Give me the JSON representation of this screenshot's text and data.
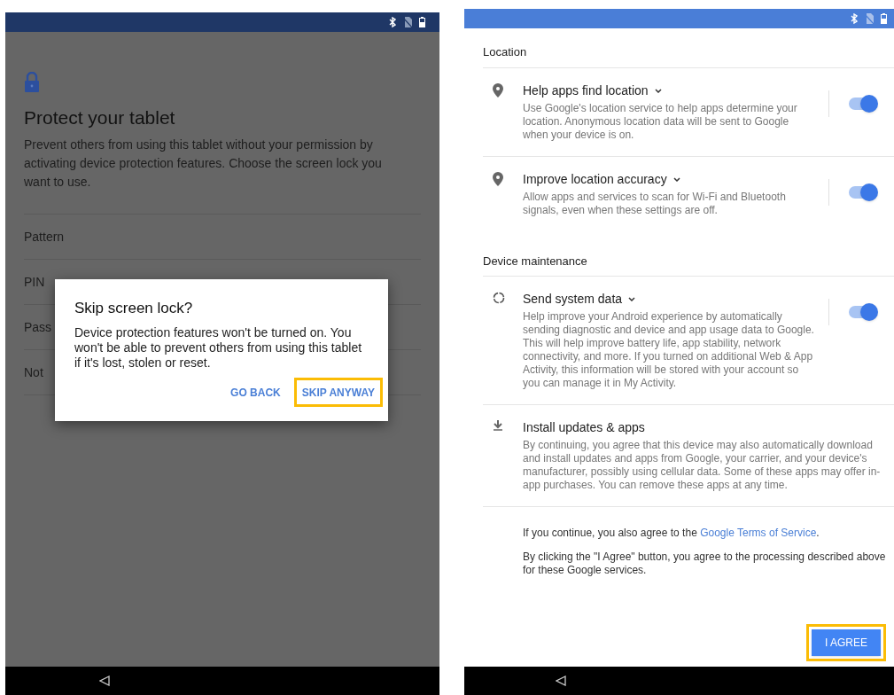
{
  "left_screen": {
    "title": "Protect your tablet",
    "description": "Prevent others from using this tablet without your permission by activating device protection features. Choose the screen lock you want to use.",
    "lock_options": [
      {
        "label": "Pattern"
      },
      {
        "label": "PIN"
      },
      {
        "label": "Pass"
      },
      {
        "label": "Not"
      }
    ],
    "dialog": {
      "title": "Skip screen lock?",
      "message": "Device protection features won't be turned on. You won't be able to prevent others from using this tablet if it's lost, stolen or reset.",
      "buttons": [
        {
          "label": "GO BACK",
          "highlighted": false
        },
        {
          "label": "SKIP ANYWAY",
          "highlighted": true
        }
      ]
    }
  },
  "right_screen": {
    "sections": [
      {
        "title": "Location",
        "items": [
          {
            "kind": "toggle",
            "title": "Help apps find location",
            "expandable": true,
            "description": "Use Google's location service to help apps determine your location. Anonymous location data will be sent to Google when your device is on.",
            "on": true
          },
          {
            "kind": "toggle",
            "title": "Improve location accuracy",
            "expandable": true,
            "description": "Allow apps and services to scan for Wi-Fi and Bluetooth signals, even when these settings are off.",
            "on": true
          }
        ]
      },
      {
        "title": "Device maintenance",
        "items": [
          {
            "kind": "toggle",
            "title": "Send system data",
            "expandable": true,
            "description": "Help improve your Android experience by automatically sending diagnostic and device and app usage data to Google. This will help improve battery life, app stability, network connectivity, and more. If you turned on additional Web & App Activity, this information will be stored with your account so you can manage it in My Activity.",
            "on": true
          },
          {
            "kind": "info",
            "title": "Install updates & apps",
            "expandable": false,
            "description": "By continuing, you agree that this device may also automatically download and install updates and apps from Google, your carrier, and your device's manufacturer, possibly using cellular data. Some of these apps may offer in-app purchases. You can remove these apps at any time."
          }
        ]
      }
    ],
    "terms": {
      "prefix": "If you continue, you also agree to the ",
      "link": "Google Terms of Service",
      "suffix": "."
    },
    "consent": "By clicking the \"I Agree\" button, you agree to the processing described above for these Google services.",
    "agree_button": {
      "label": "I AGREE",
      "highlighted": true
    }
  }
}
